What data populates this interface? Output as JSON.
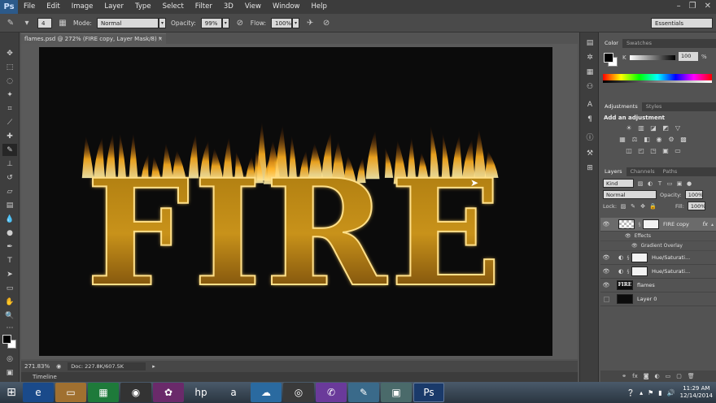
{
  "app": {
    "logo": "Ps",
    "menu": [
      "File",
      "Edit",
      "Image",
      "Layer",
      "Type",
      "Select",
      "Filter",
      "3D",
      "View",
      "Window",
      "Help"
    ],
    "window_controls": [
      "minimize-icon",
      "restore-icon",
      "close-icon"
    ]
  },
  "options": {
    "brush_size": "4",
    "mode_label": "Mode:",
    "mode_value": "Normal",
    "opacity_label": "Opacity:",
    "opacity_value": "99%",
    "flow_label": "Flow:",
    "flow_value": "100%",
    "workspace": "Essentials"
  },
  "document": {
    "tab_title": "flames.psd @ 272% (FIRE copy, Layer Mask/8) *",
    "tab_close": "×",
    "canvas_text": "FIRE",
    "zoom": "271.83%",
    "doc_size": "Doc: 227.8K/607.5K",
    "timeline_label": "Timeline"
  },
  "color_panel": {
    "tabs": [
      "Color",
      "Swatches"
    ],
    "channel_label": "K",
    "value": "100",
    "unit": "%"
  },
  "adjustments_panel": {
    "tabs": [
      "Adjustments",
      "Styles"
    ],
    "title": "Add an adjustment"
  },
  "layers_panel": {
    "tabs": [
      "Layers",
      "Channels",
      "Paths"
    ],
    "filter_kind": "Kind",
    "blend_mode": "Normal",
    "opacity_label": "Opacity:",
    "opacity_value": "100%",
    "lock_label": "Lock:",
    "fill_label": "Fill:",
    "fill_value": "100%",
    "layers": [
      {
        "name": "FIRE copy",
        "thumb": "checker",
        "has_mask": true,
        "fx": "fx",
        "visible": true,
        "selected": true
      },
      {
        "name": "Effects",
        "sub": true
      },
      {
        "name": "Gradient Overlay",
        "sub": true
      },
      {
        "name": "Hue/Saturati...",
        "thumb": "adjust",
        "visible": true
      },
      {
        "name": "Hue/Saturati...",
        "thumb": "adjust",
        "visible": true
      },
      {
        "name": "flames",
        "thumb": "fire",
        "thumb_text": "FIRE",
        "visible": true
      },
      {
        "name": "Layer 0",
        "thumb": "black",
        "visible": false
      }
    ]
  },
  "taskbar": {
    "time": "11:29 AM",
    "date": "12/14/2014"
  },
  "colors": {
    "fire_gold": "#c8921a",
    "fire_dark": "#6a3c08",
    "canvas_bg": "#0b0b0b",
    "flame_bright": "#fff2b0"
  }
}
